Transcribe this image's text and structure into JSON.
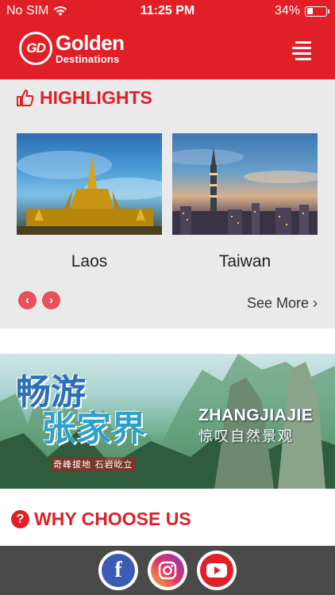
{
  "status_bar": {
    "carrier": "No SIM",
    "time": "11:25 PM",
    "battery": "34%"
  },
  "header": {
    "logo_mark": "GD",
    "logo_big": "Golden",
    "logo_small": "Destinations"
  },
  "highlights": {
    "title": "HIGHLIGHTS",
    "cards": [
      {
        "label": "Laos"
      },
      {
        "label": "Taiwan"
      }
    ],
    "see_more": "See More",
    "prev": "‹",
    "next": "›"
  },
  "banner": {
    "cn_title_line1": "畅游",
    "cn_title_line2": "张家界",
    "slogan": "奇峰拔地 石岩屹立",
    "en_title": "ZHANGJIAJIE",
    "cn_subtitle": "惊叹自然景观"
  },
  "why": {
    "title": "WHY CHOOSE US",
    "icon": "?"
  },
  "footer": {
    "facebook": "f",
    "instagram": "instagram-icon",
    "youtube": "youtube-icon"
  },
  "colors": {
    "brand_red": "#e01f26",
    "section_bg": "#eaeaea",
    "footer_bg": "#4a4a4a"
  }
}
